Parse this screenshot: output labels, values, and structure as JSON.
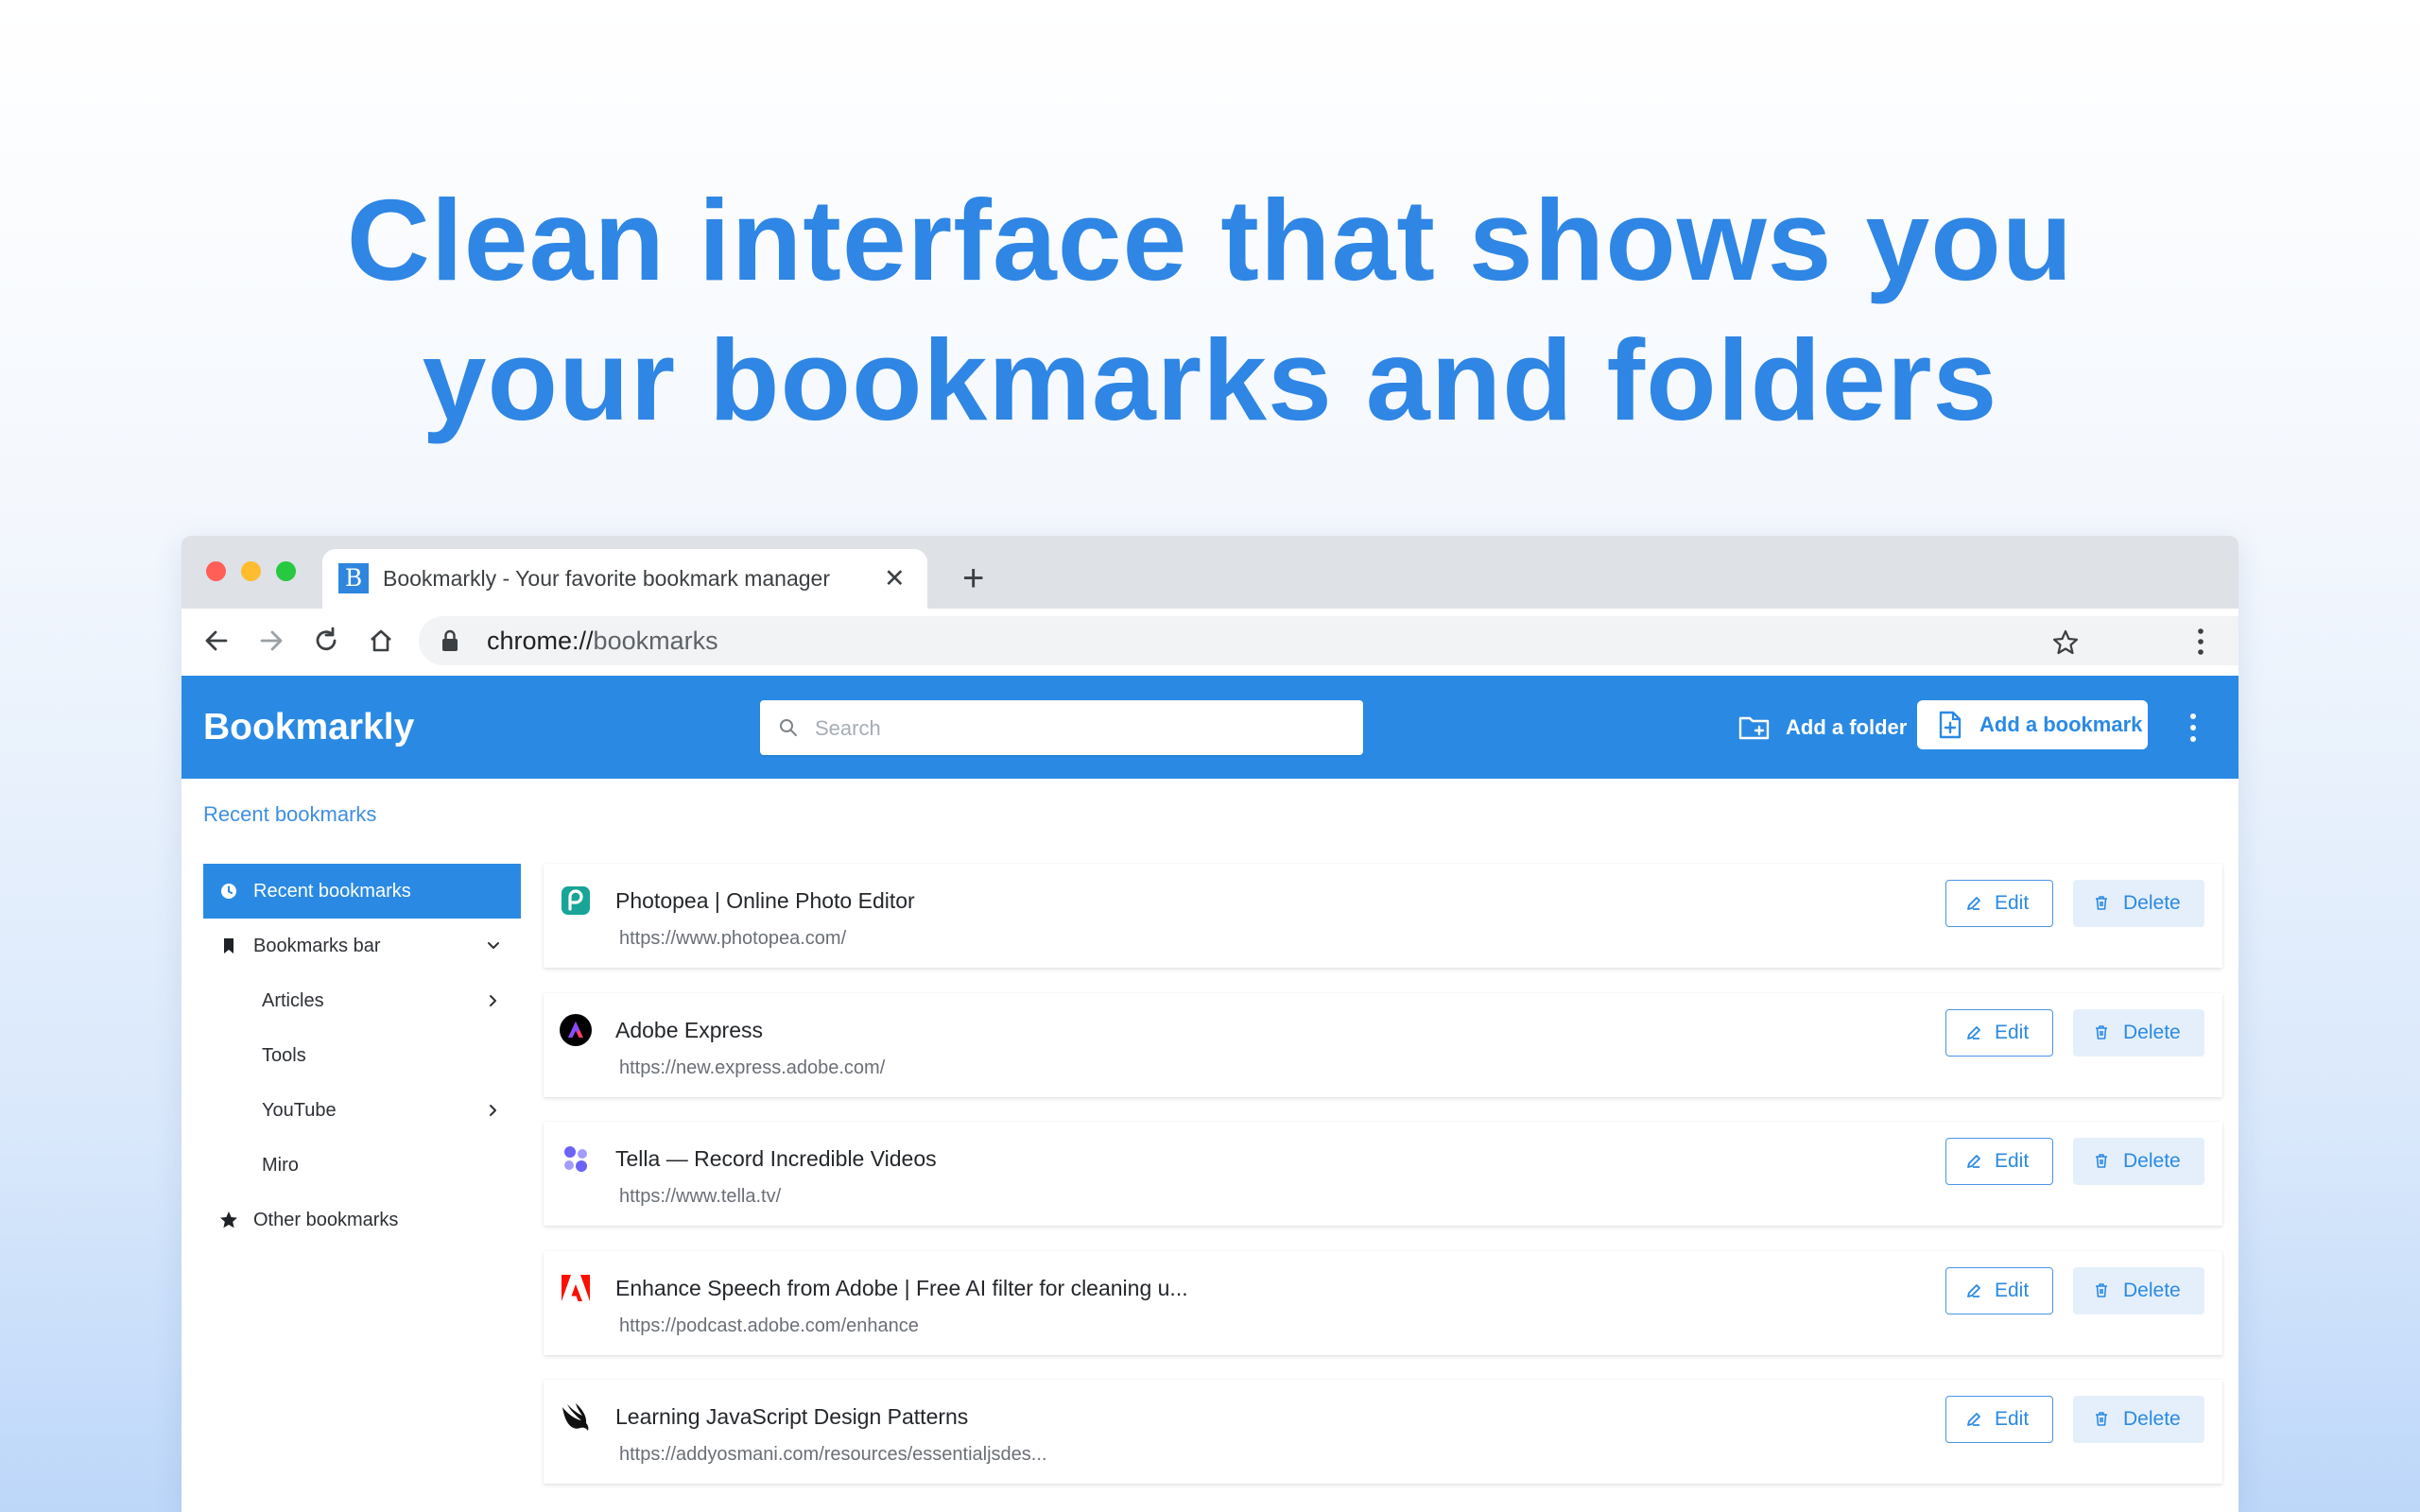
{
  "headline": {
    "line1": "Clean interface that shows you",
    "line2": "your bookmarks and folders"
  },
  "browser": {
    "tab_title": "Bookmarkly - Your favorite bookmark manager",
    "tab_favicon_letter": "B",
    "close_glyph": "✕",
    "new_tab_glyph": "+",
    "url_scheme": "chrome://",
    "url_path": "bookmarks"
  },
  "app": {
    "brand": "Bookmarkly",
    "search_placeholder": "Search",
    "add_folder_label": "Add a folder",
    "add_bookmark_label": "Add a bookmark",
    "breadcrumb": "Recent bookmarks",
    "accent_color": "#2a8ae3"
  },
  "sidebar": {
    "items": [
      {
        "label": "Recent bookmarks",
        "icon": "clock-icon",
        "active": true
      },
      {
        "label": "Bookmarks bar",
        "icon": "bookmark-icon",
        "expanded": true
      },
      {
        "label": "Articles",
        "child": true,
        "has_children": true
      },
      {
        "label": "Tools",
        "child": true
      },
      {
        "label": "YouTube",
        "child": true,
        "has_children": true
      },
      {
        "label": "Miro",
        "child": true
      },
      {
        "label": "Other bookmarks",
        "icon": "star-icon"
      }
    ]
  },
  "bookmarks": [
    {
      "title": "Photopea | Online Photo Editor",
      "url": "https://www.photopea.com/",
      "icon": "photopea-icon",
      "edit_label": "Edit",
      "delete_label": "Delete"
    },
    {
      "title": "Adobe Express",
      "url": "https://new.express.adobe.com/",
      "icon": "adobe-express-icon",
      "edit_label": "Edit",
      "delete_label": "Delete"
    },
    {
      "title": "Tella — Record Incredible Videos",
      "url": "https://www.tella.tv/",
      "icon": "tella-icon",
      "edit_label": "Edit",
      "delete_label": "Delete"
    },
    {
      "title": "Enhance Speech from Adobe | Free AI filter for cleaning u...",
      "url": "https://podcast.adobe.com/enhance",
      "icon": "adobe-icon",
      "edit_label": "Edit",
      "delete_label": "Delete"
    },
    {
      "title": "Learning JavaScript Design Patterns",
      "url": "https://addyosmani.com/resources/essentialjsdes...",
      "icon": "swift-bird-icon",
      "edit_label": "Edit",
      "delete_label": "Delete"
    }
  ]
}
